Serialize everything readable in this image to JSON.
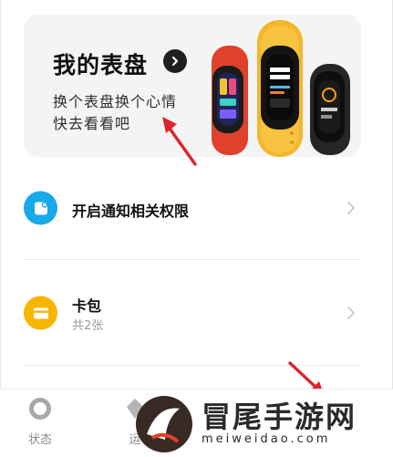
{
  "banner": {
    "title": "我的表盘",
    "subtitle_line1": "换个表盘换个心情",
    "subtitle_line2": "快去看看吧"
  },
  "rows": [
    {
      "title": "开启通知相关权限",
      "icon": "notification-icon"
    },
    {
      "title": "卡包",
      "subtitle": "共2张",
      "icon": "wallet-card-icon"
    }
  ],
  "bottom_nav": [
    {
      "label": "状态",
      "icon": "status-ring-icon"
    },
    {
      "label": "运",
      "icon": "exercise-icon"
    }
  ],
  "watermark": {
    "text": "冒尾手游网",
    "url": "meiweidao.com"
  },
  "colors": {
    "accent_blue": "#18a9ea",
    "accent_yellow": "#f7b500",
    "annotation_red": "#d9252b",
    "banner_bg": "#f4f4f4"
  }
}
